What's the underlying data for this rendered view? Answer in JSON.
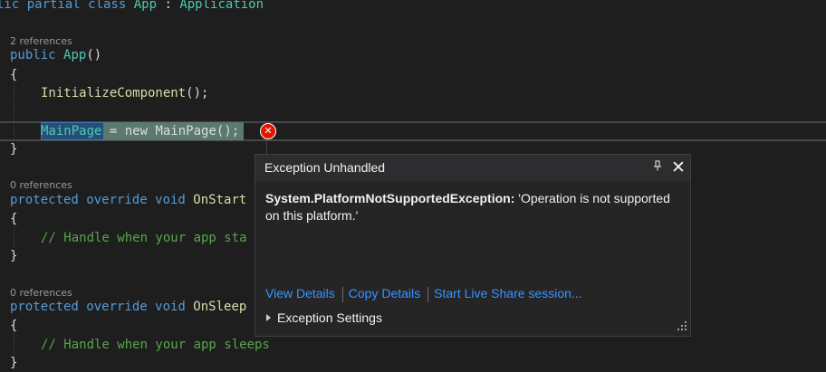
{
  "editor": {
    "lines": {
      "class_decl": {
        "kw": "lic partial class ",
        "name": "App",
        "sep": " : ",
        "base": "Application"
      },
      "lens1": "2 references",
      "ctor": {
        "kw": "public ",
        "name": "App",
        "rest": "()"
      },
      "open1": "{",
      "init": {
        "name": "InitializeComponent",
        "rest": "();"
      },
      "mainpage": {
        "sel": "MainPage",
        "mid": " = new ",
        "type": "MainPage",
        "rest": "();"
      },
      "close1": "}",
      "lens2": "0 references",
      "onstart": {
        "kw": "protected override void ",
        "name": "OnStart"
      },
      "open2": "{",
      "comment1": "// Handle when your app sta",
      "close2": "}",
      "lens3": "0 references",
      "onsleep": {
        "kw": "protected override void ",
        "name": "OnSleep"
      },
      "open3": "{",
      "comment2": "// Handle when your app sleeps",
      "close3": "}"
    }
  },
  "exception_popup": {
    "title": "Exception Unhandled",
    "pin_icon": "pin-icon",
    "close_icon": "close-icon",
    "exception_type": "System.PlatformNotSupportedException:",
    "exception_message": " 'Operation is not supported on this platform.'",
    "links": {
      "view_details": "View Details",
      "copy_details": "Copy Details",
      "live_share": "Start Live Share session..."
    },
    "settings_label": "Exception Settings"
  },
  "colors": {
    "background": "#1e1e1e",
    "keyword": "#569cd6",
    "type": "#4ec9b0",
    "method": "#dcdcaa",
    "comment": "#57a64a",
    "link": "#3794ff",
    "error": "#e51400"
  }
}
